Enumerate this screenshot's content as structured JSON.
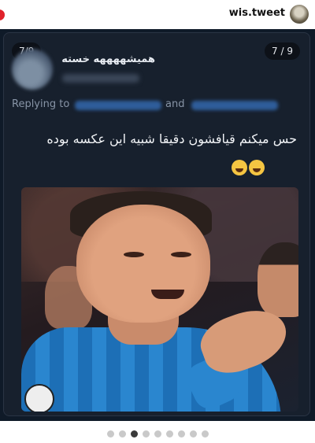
{
  "topbar": {
    "username": "wis.tweet"
  },
  "post": {
    "counter_left": "7/9",
    "counter_right": "7 / 9",
    "tweet": {
      "display_name": "همیشههههه خسته",
      "replying_label": "Replying to",
      "and_label": "and",
      "text": "حس میکنم قیافشون دقیقا شبیه این عکسه بوده"
    }
  },
  "pagination": {
    "total": 9,
    "active_index": 2
  },
  "icons": [
    "notification-dot-icon",
    "avatar-icon",
    "emoji-laugh-icon"
  ],
  "colors": {
    "card_bg": "#17202d",
    "post_bg": "#0f1a28",
    "accent_red": "#e0222b",
    "mention_blue": "#2f5d9a"
  }
}
